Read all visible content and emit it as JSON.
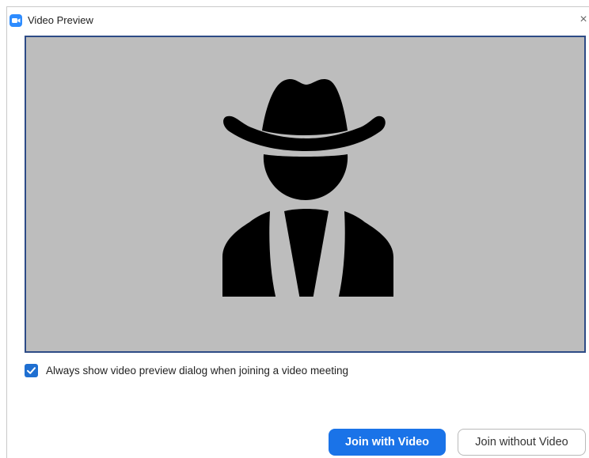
{
  "window": {
    "title": "Video Preview",
    "close_glyph": "×"
  },
  "icons": {
    "app": "zoom-camera-icon",
    "close": "close-icon",
    "avatar": "cowboy-user-avatar-icon",
    "checkmark": "checkmark-icon"
  },
  "preview": {
    "background_color": "#bdbdbd",
    "border_color": "#2d4b86"
  },
  "options": {
    "always_show_label": "Always show video preview dialog when joining a video meeting",
    "always_show_checked": true
  },
  "actions": {
    "join_with_video_label": "Join with Video",
    "join_without_video_label": "Join without Video"
  },
  "colors": {
    "accent": "#1a73e8",
    "checkbox": "#1f6fd1"
  }
}
